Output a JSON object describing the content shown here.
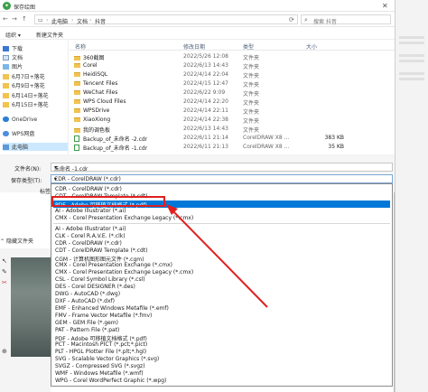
{
  "dialog": {
    "title": "保存绘图"
  },
  "address": {
    "crumbs": [
      "此电脑",
      "文档",
      "抖音"
    ],
    "search_placeholder": "搜索 抖音"
  },
  "toolbar": {
    "organize": "组织 ▾",
    "new_folder": "新建文件夹"
  },
  "nav": {
    "items": [
      {
        "label": "下载",
        "icon": "download-icon"
      },
      {
        "label": "文档",
        "icon": "document-icon"
      },
      {
        "label": "图片",
        "icon": "picture-icon"
      },
      {
        "label": "6月7日+落花",
        "icon": "folder-icon"
      },
      {
        "label": "6月9日+落花",
        "icon": "folder-icon"
      },
      {
        "label": "6月14日+落花",
        "icon": "folder-icon"
      },
      {
        "label": "6月15日+落花",
        "icon": "folder-icon"
      },
      {
        "label": "OneDrive",
        "icon": "cloud-icon"
      },
      {
        "label": "WPS网盘",
        "icon": "cloud-icon"
      },
      {
        "label": "此电脑",
        "icon": "computer-icon"
      }
    ]
  },
  "files": {
    "headers": {
      "name": "名称",
      "date": "修改日期",
      "type": "类型",
      "size": "大小"
    },
    "rows": [
      {
        "name": "360截图",
        "date": "2022/5/26 12:08",
        "type": "文件夹",
        "size": "",
        "kind": "folder"
      },
      {
        "name": "Corel",
        "date": "2022/6/13 14:43",
        "type": "文件夹",
        "size": "",
        "kind": "folder"
      },
      {
        "name": "HeidiSQL",
        "date": "2022/4/14 22:04",
        "type": "文件夹",
        "size": "",
        "kind": "folder"
      },
      {
        "name": "Tencent Files",
        "date": "2022/4/15 12:47",
        "type": "文件夹",
        "size": "",
        "kind": "folder"
      },
      {
        "name": "WeChat Files",
        "date": "2022/6/22 9:09",
        "type": "文件夹",
        "size": "",
        "kind": "folder"
      },
      {
        "name": "WPS Cloud Files",
        "date": "2022/4/14 22:20",
        "type": "文件夹",
        "size": "",
        "kind": "folder"
      },
      {
        "name": "WPSDrive",
        "date": "2022/4/14 22:11",
        "type": "文件夹",
        "size": "",
        "kind": "folder"
      },
      {
        "name": "XiaoXiong",
        "date": "2022/4/14 22:38",
        "type": "文件夹",
        "size": "",
        "kind": "folder"
      },
      {
        "name": "我的调色板",
        "date": "2022/6/13 14:43",
        "type": "文件夹",
        "size": "",
        "kind": "folder"
      },
      {
        "name": "Backup_of_未命名 -2.cdr",
        "date": "2022/6/11 21:14",
        "type": "CorelDRAW X8 ...",
        "size": "383 KB",
        "kind": "cdr"
      },
      {
        "name": "Backup_of_未命名 -1.cdr",
        "date": "2022/6/11 21:13",
        "type": "CorelDRAW X8 ...",
        "size": "35 KB",
        "kind": "cdr"
      }
    ]
  },
  "form": {
    "filename_label": "文件名(N):",
    "filename_value": "未命名 -1.cdr",
    "savetype_label": "保存类型(T):",
    "savetype_value": "CDR - CorelDRAW (*.cdr)",
    "tags_label": "标签:",
    "hide_folders": "隐藏文件夹"
  },
  "dropdown": {
    "options": [
      "CDR - CorelDRAW (*.cdr)",
      "CDT - CorelDRAW Template (*.cdt)",
      "PDF - Adobe 可移植文档格式 (*.pdf)",
      "AI - Adobe Illustrator (*.ai)",
      "CMX - Corel Presentation Exchange Legacy (*.cmx)",
      "AI - Adobe Illustrator (*.ai)",
      "CLK - Corel R.A.V.E. (*.clk)",
      "CDR - CorelDRAW (*.cdr)",
      "CDT - CorelDRAW Template (*.cdt)",
      "CGM - 计算机图形图元文件 (*.cgm)",
      "CMX - Corel Presentation Exchange (*.cmx)",
      "CMX - Corel Presentation Exchange Legacy (*.cmx)",
      "CSL - Corel Symbol Library (*.csl)",
      "DES - Corel DESIGNER (*.des)",
      "DWG - AutoCAD (*.dwg)",
      "DXF - AutoCAD (*.dxf)",
      "EMF - Enhanced Windows Metafile (*.emf)",
      "FMV - Frame Vector Metafile (*.fmv)",
      "GEM - GEM File (*.gem)",
      "PAT - Pattern File (*.pat)",
      "PDF - Adobe 可移植文档格式 (*.pdf)",
      "PCT - Macintosh PICT (*.pct;*.pict)",
      "PLT - HPGL Plotter File (*.plt;*.hgl)",
      "SVG - Scalable Vector Graphics (*.svg)",
      "SVGZ - Compressed SVG (*.svgz)",
      "WMF - Windows Metafile (*.wmf)",
      "WPG - Corel WordPerfect Graphic (*.wpg)"
    ],
    "selected_index": 2,
    "highlight_color": "#0078d7",
    "annotation_color": "#e02020"
  }
}
